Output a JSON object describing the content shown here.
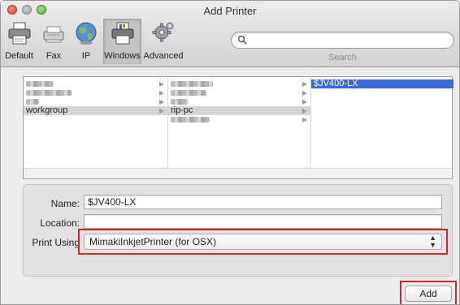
{
  "window": {
    "title": "Add Printer",
    "controls": [
      "close",
      "minimize",
      "zoom"
    ]
  },
  "toolbar": {
    "items": [
      {
        "label": "Default",
        "icon": "default-printer-icon",
        "selected": false
      },
      {
        "label": "Fax",
        "icon": "fax-icon",
        "selected": false
      },
      {
        "label": "IP",
        "icon": "globe-icon",
        "selected": false
      },
      {
        "label": "Windows",
        "icon": "windows-printer-icon",
        "selected": true
      },
      {
        "label": "Advanced",
        "icon": "gear-icon",
        "selected": false
      }
    ],
    "search": {
      "value": "",
      "caption": "Search"
    }
  },
  "browser": {
    "columns": [
      {
        "rows": [
          {
            "text": "",
            "obscured": true,
            "has_children": true
          },
          {
            "text": "",
            "obscured": true,
            "has_children": true
          },
          {
            "text": "",
            "obscured": true,
            "has_children": true
          },
          {
            "text": "workgroup",
            "obscured": false,
            "has_children": true,
            "selected": true
          }
        ]
      },
      {
        "rows": [
          {
            "text": "",
            "obscured": true,
            "has_children": true
          },
          {
            "text": "",
            "obscured": true,
            "has_children": true
          },
          {
            "text": "",
            "obscured": true,
            "has_children": true
          },
          {
            "text": "rip-pc",
            "obscured": false,
            "has_children": true,
            "selected": true
          },
          {
            "text": "",
            "obscured": true,
            "has_children": true
          }
        ]
      },
      {
        "rows": [
          {
            "text": "$JV400-LX",
            "obscured": false,
            "has_children": false,
            "selected": true
          }
        ]
      }
    ]
  },
  "form": {
    "name_label": "Name:",
    "name_value": "$JV400-LX",
    "location_label": "Location:",
    "location_value": "",
    "print_using_label": "Print Using",
    "print_using_value": "MimakiInkjetPrinter (for OSX)"
  },
  "actions": {
    "add_label": "Add"
  },
  "colors": {
    "selection_blue": "#3a6ad6",
    "highlight_red": "#d1262e"
  }
}
